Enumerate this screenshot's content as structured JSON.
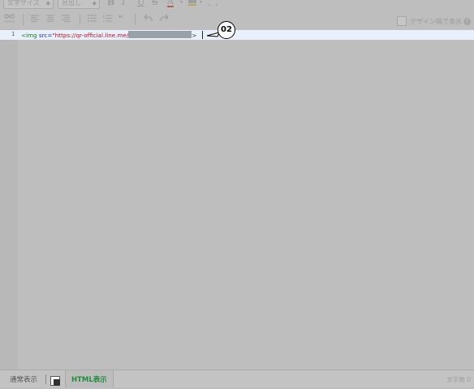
{
  "toolbar": {
    "font_size_placeholder": "文字サイズ",
    "heading_placeholder": "見出し",
    "bold": "B",
    "italic": "I",
    "underline": "U",
    "strike": "S",
    "font_color": "A",
    "design_width_label": "デザイン幅で表示",
    "help_symbol": "?"
  },
  "editor": {
    "line_number": "1",
    "code_tag_open": "<img",
    "code_attr": " src=",
    "code_string": "\"https://qr-official.line.me/",
    "code_close": ">"
  },
  "annotation": {
    "label": "02"
  },
  "footer": {
    "tab_normal": "通常表示",
    "tab_html": "HTML表示",
    "char_count": "文字数 0"
  }
}
